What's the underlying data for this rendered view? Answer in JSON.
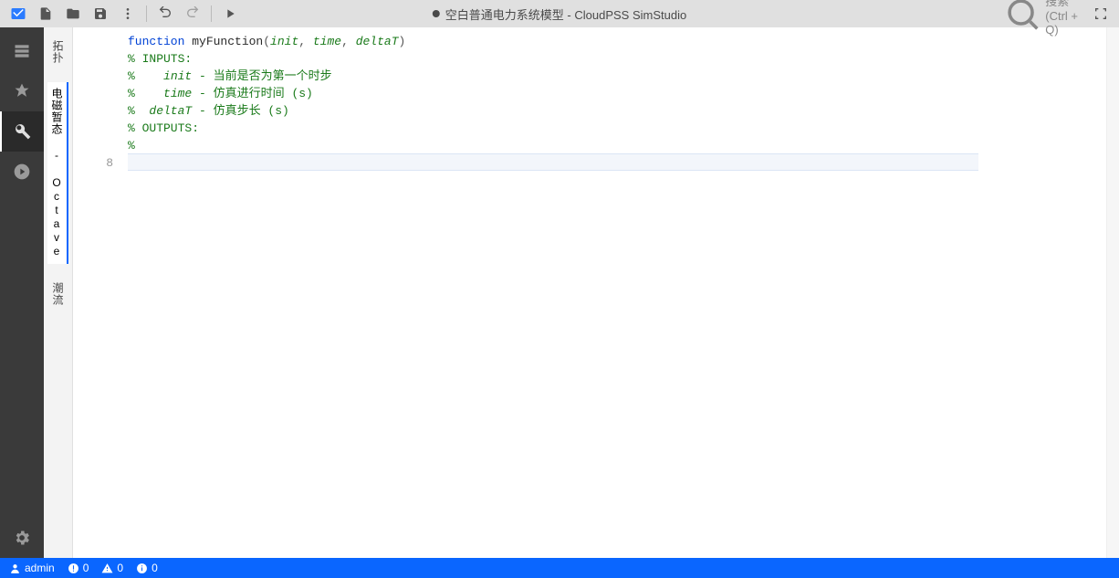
{
  "toolbar": {
    "title": "空白普通电力系统模型 - CloudPSS SimStudio",
    "search_placeholder": "搜索 (Ctrl + Q)",
    "modified": true
  },
  "sidebar_tabs": [
    {
      "label": "拓扑",
      "active": false
    },
    {
      "label": "电磁暂态 - Octave",
      "active": true
    },
    {
      "label": "潮流",
      "active": false
    }
  ],
  "editor": {
    "gutter": [
      "",
      "",
      "",
      "",
      "",
      "",
      "",
      "8"
    ],
    "lines": [
      [
        {
          "t": "function ",
          "c": "kw"
        },
        {
          "t": "myFunction",
          "c": "ident"
        },
        {
          "t": "(",
          "c": "op"
        },
        {
          "t": "init",
          "c": "param"
        },
        {
          "t": ", ",
          "c": "op"
        },
        {
          "t": "time",
          "c": "param"
        },
        {
          "t": ", ",
          "c": "op"
        },
        {
          "t": "deltaT",
          "c": "param"
        },
        {
          "t": ")",
          "c": "op"
        }
      ],
      [
        {
          "t": "% INPUTS:",
          "c": "comment"
        }
      ],
      [
        {
          "t": "%    ",
          "c": "comment"
        },
        {
          "t": "init",
          "c": "param"
        },
        {
          "t": " - 当前是否为第一个时步",
          "c": "comment"
        }
      ],
      [
        {
          "t": "%    ",
          "c": "comment"
        },
        {
          "t": "time",
          "c": "param"
        },
        {
          "t": " - 仿真进行时间 (s)",
          "c": "comment"
        }
      ],
      [
        {
          "t": "%  ",
          "c": "comment"
        },
        {
          "t": "deltaT",
          "c": "param"
        },
        {
          "t": " - 仿真步长 (s)",
          "c": "comment"
        }
      ],
      [
        {
          "t": "% OUTPUTS:",
          "c": "comment"
        }
      ],
      [
        {
          "t": "%",
          "c": "comment"
        }
      ],
      [
        {
          "t": "",
          "c": ""
        }
      ]
    ],
    "current_line": 7
  },
  "status": {
    "user": "admin",
    "errors": "0",
    "warnings": "0",
    "info": "0"
  }
}
